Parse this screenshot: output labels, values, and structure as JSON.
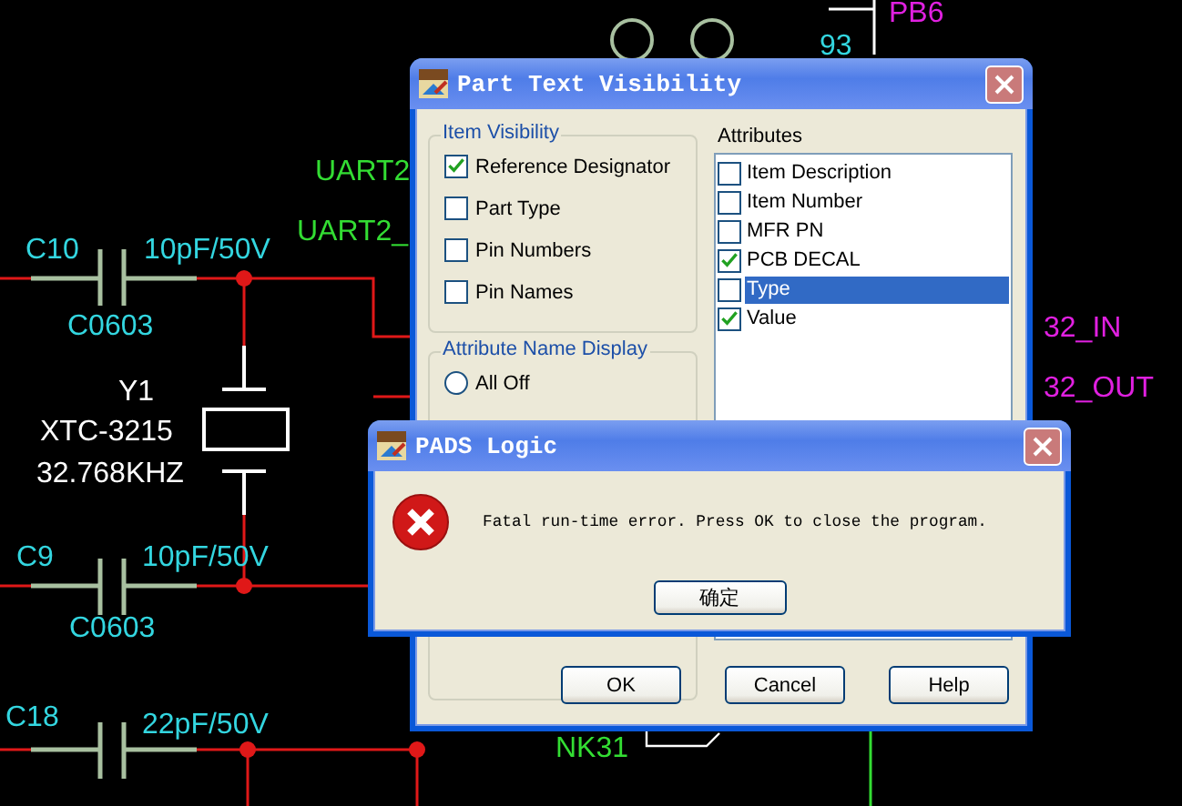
{
  "schematic": {
    "labels": [
      {
        "text": "PB6",
        "kind": "net-alt"
      },
      {
        "text": "93",
        "kind": "pin"
      },
      {
        "text": "UART2",
        "kind": "net"
      },
      {
        "text": "UART2_",
        "kind": "net"
      },
      {
        "text": "C10",
        "kind": "ref"
      },
      {
        "text": "10pF/50V",
        "kind": "ref"
      },
      {
        "text": "C0603",
        "kind": "ref"
      },
      {
        "text": "Y1",
        "kind": "part"
      },
      {
        "text": "XTC-3215",
        "kind": "part"
      },
      {
        "text": "32.768KHZ",
        "kind": "part"
      },
      {
        "text": "C9",
        "kind": "ref"
      },
      {
        "text": "10pF/50V",
        "kind": "ref"
      },
      {
        "text": "C0603",
        "kind": "ref"
      },
      {
        "text": "C18",
        "kind": "ref"
      },
      {
        "text": "22pF/50V",
        "kind": "ref"
      },
      {
        "text": "32_IN",
        "kind": "net-alt"
      },
      {
        "text": "32_OUT",
        "kind": "net-alt"
      },
      {
        "text": "NK31",
        "kind": "net"
      }
    ]
  },
  "part_text_dialog": {
    "title": "Part Text Visibility",
    "item_visibility": {
      "title": "Item Visibility",
      "items": [
        {
          "label": "Reference Designator",
          "checked": true
        },
        {
          "label": "Part Type",
          "checked": false
        },
        {
          "label": "Pin Numbers",
          "checked": false
        },
        {
          "label": "Pin Names",
          "checked": false
        }
      ]
    },
    "attributes": {
      "title": "Attributes",
      "items": [
        {
          "label": "Item Description",
          "checked": false,
          "selected": false
        },
        {
          "label": "Item Number",
          "checked": false,
          "selected": false
        },
        {
          "label": "MFR PN",
          "checked": false,
          "selected": false
        },
        {
          "label": "PCB DECAL",
          "checked": true,
          "selected": false
        },
        {
          "label": "Type",
          "checked": false,
          "selected": true
        },
        {
          "label": "Value",
          "checked": true,
          "selected": false
        }
      ]
    },
    "attribute_name_display": {
      "title": "Attribute Name Display",
      "options": [
        {
          "label": "All Off",
          "selected": false
        }
      ]
    },
    "buttons": [
      "OK",
      "Cancel",
      "Help"
    ]
  },
  "error_dialog": {
    "title": "PADS Logic",
    "message": "Fatal run-time error. Press OK to close the program.",
    "button": "确定"
  }
}
